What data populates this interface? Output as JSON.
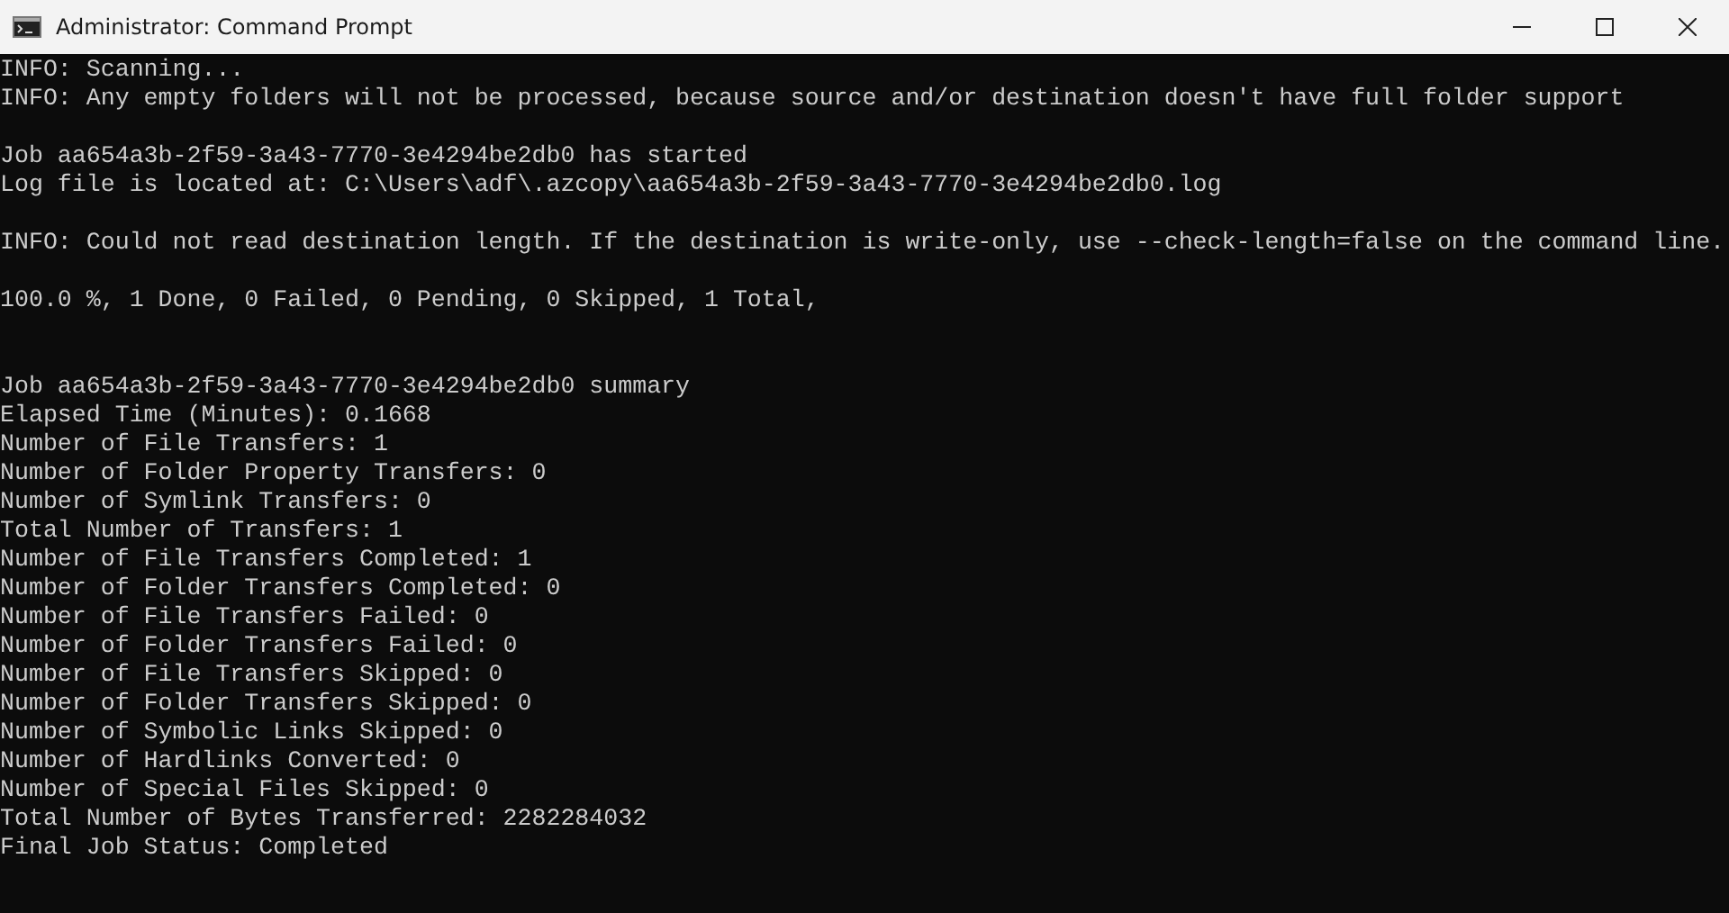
{
  "window": {
    "title": "Administrator: Command Prompt"
  },
  "console": {
    "lines": [
      {
        "kind": "text",
        "text": "INFO: Scanning..."
      },
      {
        "kind": "text",
        "text": "INFO: Any empty folders will not be processed, because source and/or destination doesn't have full folder support"
      },
      {
        "kind": "blank"
      },
      {
        "kind": "text",
        "text": "Job aa654a3b-2f59-3a43-7770-3e4294be2db0 has started"
      },
      {
        "kind": "text",
        "text": "Log file is located at: C:\\Users\\adf\\.azcopy\\aa654a3b-2f59-3a43-7770-3e4294be2db0.log"
      },
      {
        "kind": "blank"
      },
      {
        "kind": "text",
        "text": "INFO: Could not read destination length. If the destination is write-only, use --check-length=false on the command line."
      },
      {
        "kind": "blank"
      },
      {
        "kind": "text",
        "text": "100.0 %, 1 Done, 0 Failed, 0 Pending, 0 Skipped, 1 Total,"
      },
      {
        "kind": "blank"
      },
      {
        "kind": "blank"
      },
      {
        "kind": "text",
        "text": "Job aa654a3b-2f59-3a43-7770-3e4294be2db0 summary"
      },
      {
        "kind": "text",
        "text": "Elapsed Time (Minutes): 0.1668"
      },
      {
        "kind": "text",
        "text": "Number of File Transfers: 1"
      },
      {
        "kind": "text",
        "text": "Number of Folder Property Transfers: 0"
      },
      {
        "kind": "text",
        "text": "Number of Symlink Transfers: 0"
      },
      {
        "kind": "text",
        "text": "Total Number of Transfers: 1"
      },
      {
        "kind": "text",
        "text": "Number of File Transfers Completed: 1"
      },
      {
        "kind": "text",
        "text": "Number of Folder Transfers Completed: 0"
      },
      {
        "kind": "text",
        "text": "Number of File Transfers Failed: 0"
      },
      {
        "kind": "text",
        "text": "Number of Folder Transfers Failed: 0"
      },
      {
        "kind": "text",
        "text": "Number of File Transfers Skipped: 0"
      },
      {
        "kind": "text",
        "text": "Number of Folder Transfers Skipped: 0"
      },
      {
        "kind": "text",
        "text": "Number of Symbolic Links Skipped: 0"
      },
      {
        "kind": "text",
        "text": "Number of Hardlinks Converted: 0"
      },
      {
        "kind": "text",
        "text": "Number of Special Files Skipped: 0"
      },
      {
        "kind": "text",
        "text": "Total Number of Bytes Transferred: 2282284032"
      },
      {
        "kind": "text",
        "text": "Final Job Status: Completed"
      }
    ]
  }
}
